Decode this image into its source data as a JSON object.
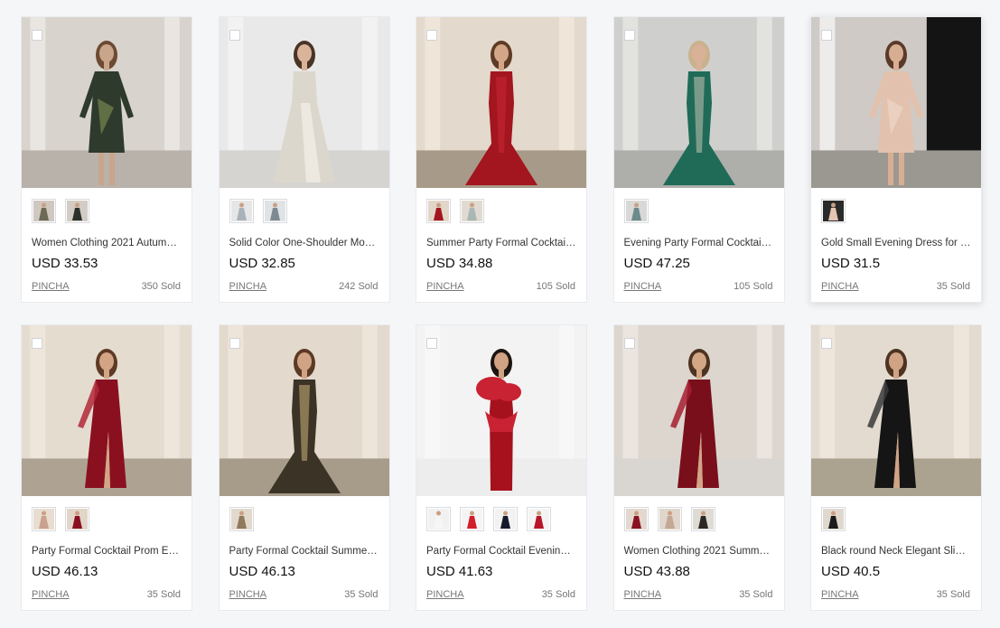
{
  "products": [
    {
      "title": "Women Clothing 2021 Autumn ...",
      "price": "USD 33.53",
      "store": "PINCHA",
      "sold": "350 Sold",
      "bg": "#d8d3cd",
      "wall": "#ebe7e2",
      "floor": "#b9b2aa",
      "dress": "#2e3a2c",
      "dress_accent": "#8a9a5a",
      "skin": "#c9a58c",
      "hair": "#6d4a32",
      "style": "short",
      "swatches": [
        {
          "bg": "#cfc8c0",
          "dress": "#6c6a55"
        },
        {
          "bg": "#d2ccc4",
          "dress": "#2b322b"
        }
      ]
    },
    {
      "title": "Solid Color One-Shoulder Mop...",
      "price": "USD 32.85",
      "store": "PINCHA",
      "sold": "242 Sold",
      "bg": "#e9e9e9",
      "wall": "#f3f3f3",
      "floor": "#d6d4d1",
      "dress": "#dcd7cc",
      "dress_accent": "#f4f1ea",
      "skin": "#d9b39a",
      "hair": "#4a3426",
      "style": "gown",
      "swatches": [
        {
          "bg": "#e6e6e6",
          "dress": "#aab2b9"
        },
        {
          "bg": "#dfe3e6",
          "dress": "#7e8a92"
        }
      ]
    },
    {
      "title": "Summer Party Formal Cocktail ...",
      "price": "USD 34.88",
      "store": "PINCHA",
      "sold": "105 Sold",
      "bg": "#e3d9cc",
      "wall": "#efe6da",
      "floor": "#a89a88",
      "dress": "#a3151f",
      "dress_accent": "#c92a35",
      "skin": "#d4a688",
      "hair": "#5e3b25",
      "style": "mermaid",
      "swatches": [
        {
          "bg": "#e2d6c9",
          "dress": "#a3151f"
        },
        {
          "bg": "#e1dad0",
          "dress": "#a9b8b6"
        }
      ]
    },
    {
      "title": "Evening Party Formal Cocktail D...",
      "price": "USD 47.25",
      "store": "PINCHA",
      "sold": "105 Sold",
      "bg": "#cfd0ce",
      "wall": "#e3e3e0",
      "floor": "#aeaeab",
      "dress": "#1f6b57",
      "dress_accent": "#c7c3b4",
      "skin": "#d8b196",
      "hair": "#c9b28d",
      "style": "mermaid",
      "swatches": [
        {
          "bg": "#d8d8d6",
          "dress": "#6c8b8a"
        }
      ]
    },
    {
      "title": "Gold Small Evening Dress for W...",
      "price": "USD 31.5",
      "store": "PINCHA",
      "sold": "35 Sold",
      "bg": "#cfcac6",
      "wall": "#f0efed",
      "floor": "#9b9892",
      "dress": "#e2c2ae",
      "dress_accent": "#f3dccd",
      "skin": "#d8ae93",
      "hair": "#5a3a28",
      "style": "short",
      "door": true,
      "swatches": [
        {
          "bg": "#2a2a2a",
          "dress": "#e4c6b3"
        }
      ]
    },
    {
      "title": "Party Formal Cocktail Prom Eve...",
      "price": "USD 46.13",
      "store": "PINCHA",
      "sold": "35 Sold",
      "bg": "#e5dcd0",
      "wall": "#efe7dc",
      "floor": "#aea392",
      "dress": "#8a1020",
      "dress_accent": "#b3283a",
      "skin": "#d3a585",
      "hair": "#5d3b26",
      "style": "slit",
      "swatches": [
        {
          "bg": "#e8ddd0",
          "dress": "#c9a18e"
        },
        {
          "bg": "#e2d6c9",
          "dress": "#8a1020"
        }
      ]
    },
    {
      "title": "Party Formal Cocktail Summer ...",
      "price": "USD 46.13",
      "store": "PINCHA",
      "sold": "35 Sold",
      "bg": "#e3d9cc",
      "wall": "#eee6db",
      "floor": "#a79b8a",
      "dress": "#3a3326",
      "dress_accent": "#c9b07a",
      "skin": "#d1a385",
      "hair": "#5b3a25",
      "style": "mermaid",
      "swatches": [
        {
          "bg": "#e2d8cc",
          "dress": "#8e7a5c"
        }
      ]
    },
    {
      "title": "Party Formal Cocktail Evening D...",
      "price": "USD 41.63",
      "store": "PINCHA",
      "sold": "35 Sold",
      "bg": "#f3f3f3",
      "wall": "#f7f7f7",
      "floor": "#ededed",
      "dress": "#a5121e",
      "dress_accent": "#c82233",
      "skin": "#cfa384",
      "hair": "#1d1511",
      "style": "ruffle",
      "swatches": [
        {
          "bg": "#f1f1f1",
          "dress": "#f6f6f6"
        },
        {
          "bg": "#f5f5f5",
          "dress": "#d21f2a"
        },
        {
          "bg": "#f2f2f2",
          "dress": "#161b2c"
        },
        {
          "bg": "#f4f4f4",
          "dress": "#b8142a"
        }
      ]
    },
    {
      "title": "Women Clothing 2021 Summer...",
      "price": "USD 43.88",
      "store": "PINCHA",
      "sold": "35 Sold",
      "bg": "#dcd6cf",
      "wall": "#ece7e1",
      "floor": "#d9d6d2",
      "dress": "#7a0f1c",
      "dress_accent": "#a61f30",
      "skin": "#d3a686",
      "hair": "#4e3322",
      "style": "slit",
      "swatches": [
        {
          "bg": "#e2d8ce",
          "dress": "#8a1222"
        },
        {
          "bg": "#e0d6cb",
          "dress": "#c3a896"
        },
        {
          "bg": "#dedad4",
          "dress": "#2b2723"
        }
      ]
    },
    {
      "title": "Black round Neck Elegant Slim ...",
      "price": "USD 40.5",
      "store": "PINCHA",
      "sold": "35 Sold",
      "bg": "#e3dbd0",
      "wall": "#eee6dc",
      "floor": "#aca290",
      "dress": "#151515",
      "dress_accent": "#3a3a3a",
      "skin": "#d1a385",
      "hair": "#4d3322",
      "style": "slit",
      "swatches": [
        {
          "bg": "#dfd8ce",
          "dress": "#1b1b1b"
        }
      ]
    }
  ],
  "icons": {
    "checkbox": "checkbox-icon"
  }
}
